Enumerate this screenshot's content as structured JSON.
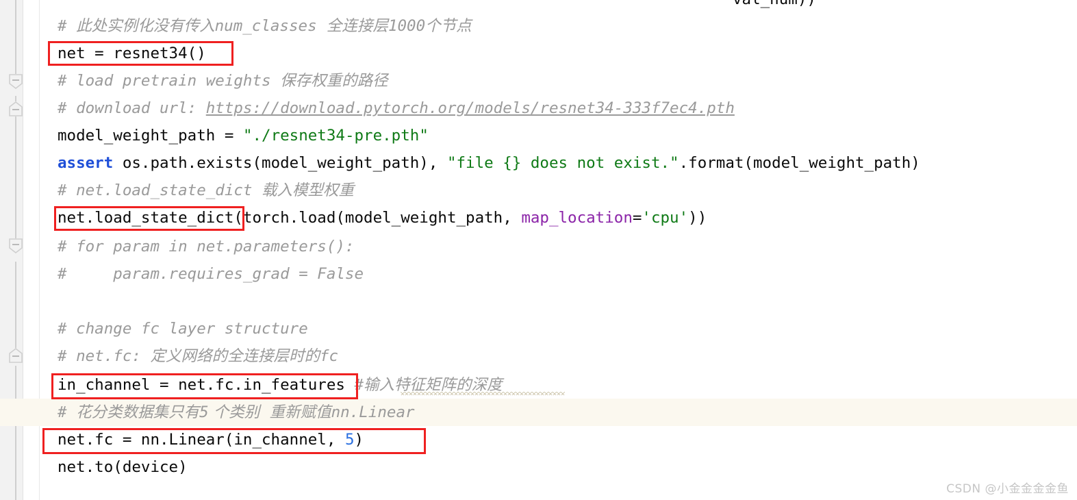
{
  "app": {
    "kind": "code-editor",
    "language": "Python",
    "background": "#ffffff",
    "gutter_color": "#f2f2f2",
    "highlight_band_color": "#fbf8ef",
    "annotation_box_color": "#ef2020"
  },
  "clipped_top_line": {
    "text": "val_num))"
  },
  "gutter": {
    "fold_markers": [
      {
        "type": "fold-block-start",
        "direction": "down",
        "glyph": "minus"
      },
      {
        "type": "fold-block-end",
        "direction": "up",
        "glyph": "minus"
      },
      {
        "type": "fold-block-start",
        "direction": "down",
        "glyph": "minus"
      },
      {
        "type": "fold-block-end",
        "direction": "up",
        "glyph": "minus"
      }
    ]
  },
  "code_lines": [
    {
      "id": "comment-num-classes",
      "indent": 1,
      "tokens": [
        {
          "t": "cmt",
          "s": "# "
        },
        {
          "t": "cmt-cn",
          "s": "此处实例化没有传入"
        },
        {
          "t": "cmt",
          "s": "num_classes"
        },
        {
          "t": "cmt-cn",
          "s": "  全连接层"
        },
        {
          "t": "cmt",
          "s": "1000"
        },
        {
          "t": "cmt-cn",
          "s": "个节点"
        }
      ]
    },
    {
      "id": "net-resnet34",
      "indent": 1,
      "boxed": true,
      "tokens": [
        {
          "t": "plain",
          "s": "net = resnet34()"
        }
      ]
    },
    {
      "id": "comment-load-pretrain",
      "indent": 1,
      "tokens": [
        {
          "t": "cmt",
          "s": "# load pretrain weights "
        },
        {
          "t": "cmt-cn",
          "s": "保存权重的路径"
        }
      ]
    },
    {
      "id": "comment-download-url",
      "indent": 1,
      "tokens": [
        {
          "t": "cmt",
          "s": "# download url: "
        },
        {
          "t": "url",
          "s": "https://download.pytorch.org/models/resnet34-333f7ec4.pth"
        }
      ]
    },
    {
      "id": "model-weight-path",
      "indent": 1,
      "tokens": [
        {
          "t": "plain",
          "s": "model_weight_path = "
        },
        {
          "t": "str",
          "s": "\"./resnet34-pre.pth\""
        }
      ]
    },
    {
      "id": "assert-exists",
      "indent": 1,
      "tokens": [
        {
          "t": "kw",
          "s": "assert"
        },
        {
          "t": "plain",
          "s": " os.path.exists(model_weight_path), "
        },
        {
          "t": "str",
          "s": "\"file {} does not exist.\""
        },
        {
          "t": "plain",
          "s": ".format(model_weight_path)"
        }
      ]
    },
    {
      "id": "comment-load-state-dict",
      "indent": 1,
      "tokens": [
        {
          "t": "cmt",
          "s": "# net.load_state_dict "
        },
        {
          "t": "cmt-cn",
          "s": "载入模型权重"
        }
      ]
    },
    {
      "id": "net-load-state-dict",
      "indent": 1,
      "boxed": true,
      "tokens": [
        {
          "t": "plain",
          "s": "net.load_state_dict(torch.load(model_weight_path, "
        },
        {
          "t": "kwarg",
          "s": "map_location"
        },
        {
          "t": "plain",
          "s": "="
        },
        {
          "t": "str",
          "s": "'cpu'"
        },
        {
          "t": "plain",
          "s": "))"
        }
      ]
    },
    {
      "id": "comment-for-param",
      "indent": 1,
      "tokens": [
        {
          "t": "cmt",
          "s": "# for param in net.parameters():"
        }
      ]
    },
    {
      "id": "comment-requires-grad",
      "indent": 1,
      "tokens": [
        {
          "t": "cmt",
          "s": "#     param.requires_grad = False"
        }
      ]
    },
    {
      "id": "blank-1",
      "indent": 1,
      "tokens": []
    },
    {
      "id": "comment-change-fc",
      "indent": 1,
      "tokens": [
        {
          "t": "cmt",
          "s": "# change fc layer structure"
        }
      ]
    },
    {
      "id": "comment-net-fc",
      "indent": 1,
      "tokens": [
        {
          "t": "cmt",
          "s": "# net.fc: "
        },
        {
          "t": "cmt-cn",
          "s": "定义网络的全连接层时的"
        },
        {
          "t": "cmt",
          "s": "fc"
        }
      ]
    },
    {
      "id": "in-channel",
      "indent": 1,
      "boxed": true,
      "tokens": [
        {
          "t": "plain",
          "s": "in_channel = net.fc.in_features "
        },
        {
          "t": "cmt",
          "s": "#"
        },
        {
          "t": "cmt-cn",
          "s": "输入特征矩阵的深度"
        }
      ]
    },
    {
      "id": "comment-flower-classes",
      "indent": 1,
      "highlighted": true,
      "tokens": [
        {
          "t": "cmt",
          "s": "# "
        },
        {
          "t": "cmt-cn",
          "s": "花分类数据集只有"
        },
        {
          "t": "cmt",
          "s": "5"
        },
        {
          "t": "cmt-cn",
          "s": " 个类别  重新赋值"
        },
        {
          "t": "cmt",
          "s": "nn.Linear"
        }
      ]
    },
    {
      "id": "net-fc-linear",
      "indent": 1,
      "boxed": true,
      "tokens": [
        {
          "t": "plain",
          "s": "net.fc = nn.Linear(in_channel, "
        },
        {
          "t": "num",
          "s": "5"
        },
        {
          "t": "plain",
          "s": ")"
        }
      ]
    },
    {
      "id": "net-to-device",
      "indent": 1,
      "tokens": [
        {
          "t": "plain",
          "s": "net.to(device)"
        }
      ]
    }
  ],
  "watermark": {
    "text": "CSDN @小金金金金鱼"
  }
}
